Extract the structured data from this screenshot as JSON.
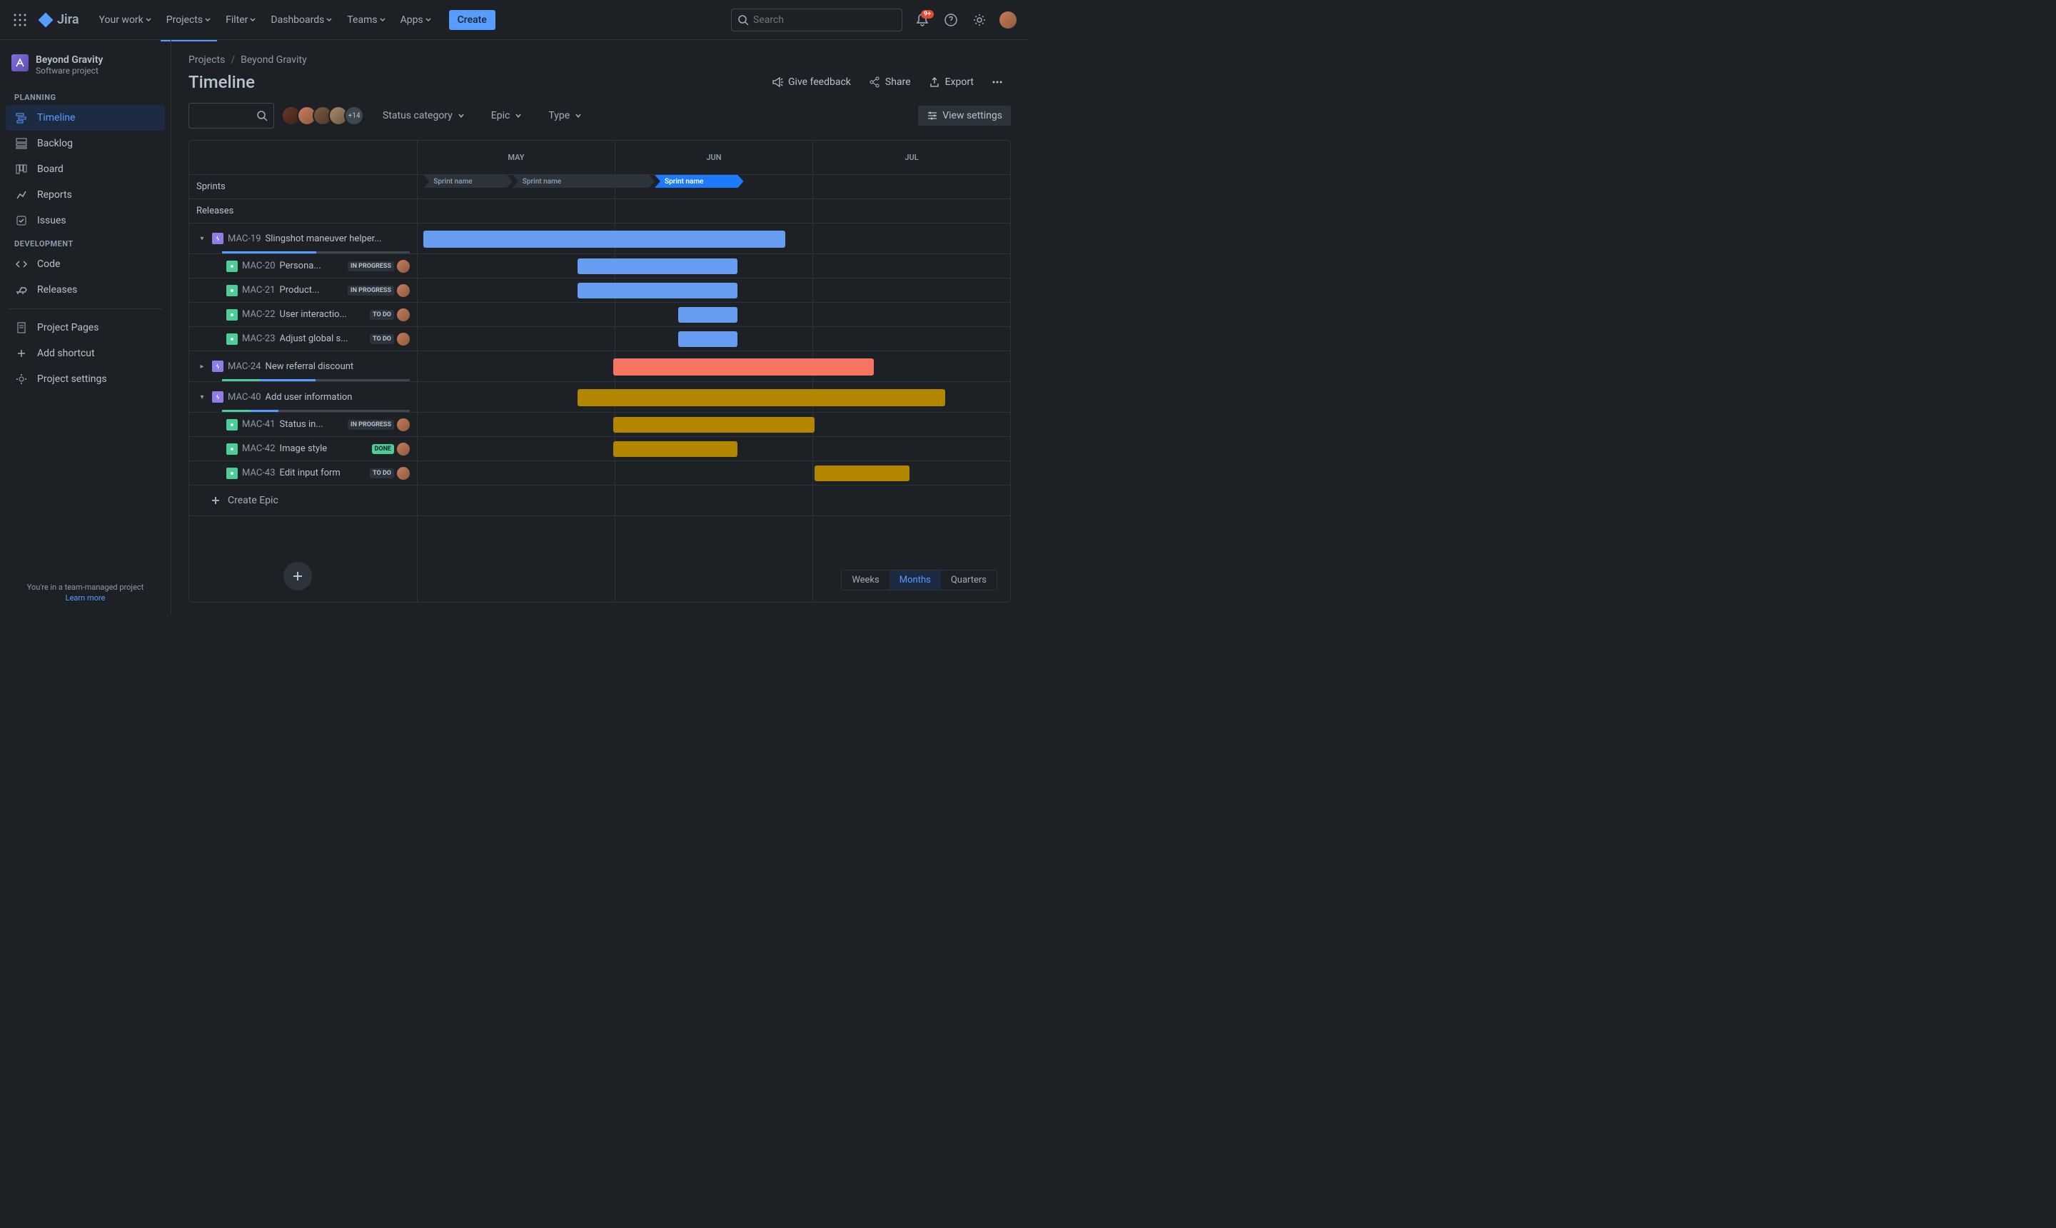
{
  "topnav": {
    "logo": "Jira",
    "links": [
      "Your work",
      "Projects",
      "Filter",
      "Dashboards",
      "Teams",
      "Apps"
    ],
    "create": "Create",
    "search_placeholder": "Search",
    "badge": "9+"
  },
  "sidebar": {
    "project_name": "Beyond Gravity",
    "project_sub": "Software project",
    "section_planning": "PLANNING",
    "section_dev": "DEVELOPMENT",
    "planning_items": [
      "Timeline",
      "Backlog",
      "Board",
      "Reports",
      "Issues"
    ],
    "dev_items": [
      "Code",
      "Releases"
    ],
    "bottom_items": [
      "Project Pages",
      "Add shortcut",
      "Project settings"
    ],
    "footer1": "You're in a team-managed project",
    "footer2": "Learn more"
  },
  "breadcrumb": {
    "a": "Projects",
    "b": "Beyond Gravity"
  },
  "page_title": "Timeline",
  "actions": {
    "feedback": "Give feedback",
    "share": "Share",
    "export": "Export"
  },
  "toolbar": {
    "status": "Status category",
    "epic": "Epic",
    "type": "Type",
    "more_avatars": "+14",
    "view": "View settings"
  },
  "timeline": {
    "months": [
      "MAY",
      "JUN",
      "JUL"
    ],
    "sprints_label": "Sprints",
    "releases_label": "Releases",
    "sprint_name": "Sprint name",
    "create_epic": "Create Epic"
  },
  "zoom": {
    "weeks": "Weeks",
    "months": "Months",
    "quarters": "Quarters"
  },
  "rows": [
    {
      "kind": "epic",
      "key": "MAC-19",
      "summary": "Slingshot maneuver helper...",
      "expanded": true,
      "color": "blue",
      "bar": [
        1,
        62
      ],
      "pdone": 0,
      "pprog": 50
    },
    {
      "kind": "story",
      "key": "MAC-20",
      "summary": "Persona...",
      "status": "IN PROGRESS",
      "scls": "progress",
      "color": "blue",
      "bar": [
        27,
        54
      ]
    },
    {
      "kind": "story",
      "key": "MAC-21",
      "summary": "Product...",
      "status": "IN PROGRESS",
      "scls": "progress",
      "color": "blue",
      "bar": [
        27,
        54
      ]
    },
    {
      "kind": "story",
      "key": "MAC-22",
      "summary": "User interactio...",
      "status": "TO DO",
      "scls": "todo",
      "color": "blue",
      "bar": [
        44,
        54
      ]
    },
    {
      "kind": "story",
      "key": "MAC-23",
      "summary": "Adjust global s...",
      "status": "TO DO",
      "scls": "todo",
      "color": "blue",
      "bar": [
        44,
        54
      ]
    },
    {
      "kind": "epic",
      "key": "MAC-24",
      "summary": "New referral discount",
      "expanded": false,
      "color": "red",
      "bar": [
        33,
        77
      ],
      "pdone": 20,
      "pprog": 30
    },
    {
      "kind": "epic",
      "key": "MAC-40",
      "summary": "Add user information",
      "expanded": true,
      "color": "yellow",
      "bar": [
        27,
        89
      ],
      "pdone": 15,
      "pprog": 15
    },
    {
      "kind": "story",
      "key": "MAC-41",
      "summary": "Status in...",
      "status": "IN PROGRESS",
      "scls": "progress",
      "color": "yellow",
      "bar": [
        33,
        67
      ]
    },
    {
      "kind": "story",
      "key": "MAC-42",
      "summary": "Image style",
      "status": "DONE",
      "scls": "done",
      "color": "yellow",
      "bar": [
        33,
        54
      ]
    },
    {
      "kind": "story",
      "key": "MAC-43",
      "summary": "Edit input form",
      "status": "TO DO",
      "scls": "todo",
      "color": "yellow",
      "bar": [
        67,
        83
      ]
    }
  ]
}
